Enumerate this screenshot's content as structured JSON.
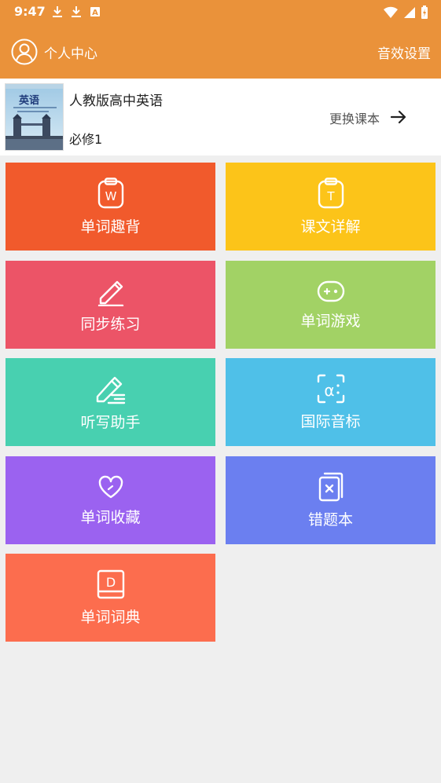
{
  "status_bar": {
    "time": "9:47",
    "icons_left": [
      "download-icon",
      "download-icon",
      "font-a-icon"
    ],
    "icons_right": [
      "wifi-icon",
      "signal-icon",
      "battery-charging-icon"
    ]
  },
  "app_bar": {
    "profile_icon": "user-circle-icon",
    "profile_label": "个人中心",
    "sound_settings_label": "音效设置",
    "background_color": "#ea923a"
  },
  "book": {
    "cover_title": "英语",
    "title": "人教版高中英语",
    "volume": "必修1",
    "change_label": "更换课本",
    "change_icon": "arrow-right-icon"
  },
  "tiles": [
    {
      "label": "单词趣背",
      "icon": "clipboard-w-icon",
      "color": "#f15a2c"
    },
    {
      "label": "课文详解",
      "icon": "clipboard-t-icon",
      "color": "#fcc419"
    },
    {
      "label": "同步练习",
      "icon": "pencil-icon",
      "color": "#ec5467"
    },
    {
      "label": "单词游戏",
      "icon": "gamepad-icon",
      "color": "#a2d265"
    },
    {
      "label": "听写助手",
      "icon": "edit-lines-icon",
      "color": "#48d0b0"
    },
    {
      "label": "国际音标",
      "icon": "alpha-phonetic-icon",
      "color": "#4fc0e8"
    },
    {
      "label": "单词收藏",
      "icon": "heart-icon",
      "color": "#9b62f0"
    },
    {
      "label": "错题本",
      "icon": "book-x-icon",
      "color": "#6b7ff0"
    },
    {
      "label": "单词词典",
      "icon": "dictionary-d-icon",
      "color": "#fc6d4e"
    }
  ]
}
